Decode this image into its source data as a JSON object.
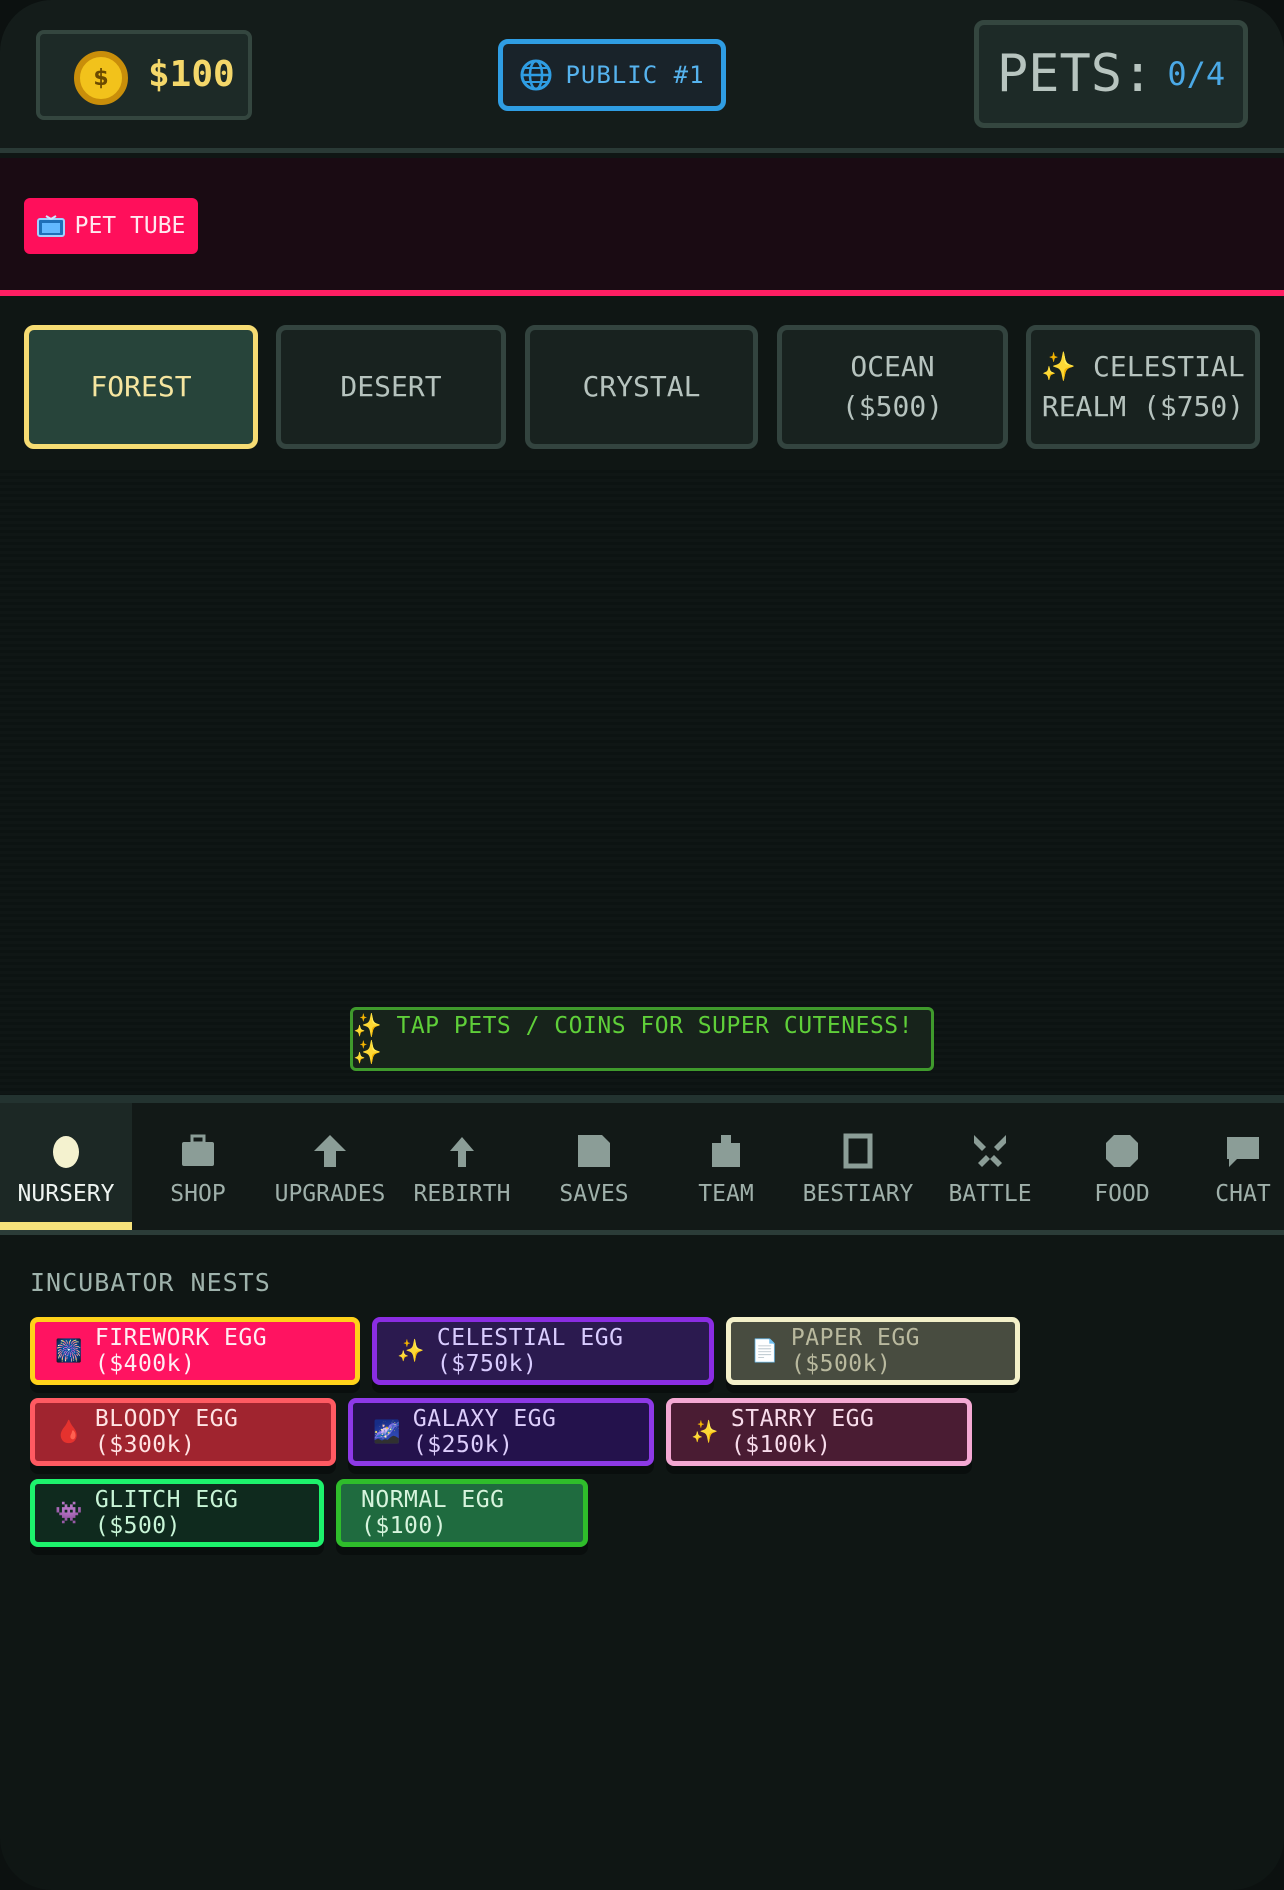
{
  "header": {
    "coins": "$100",
    "coin_symbol": "$",
    "server_label": "PUBLIC #1",
    "pets_label": "PETS:",
    "pets_count": "0/4"
  },
  "banner": {
    "tube_label": "PET TUBE"
  },
  "biomes": [
    {
      "label": "FOREST",
      "active": true
    },
    {
      "label": "DESERT",
      "active": false
    },
    {
      "label": "CRYSTAL",
      "active": false
    },
    {
      "label": "OCEAN ($500)",
      "active": false
    },
    {
      "label": "✨ CELESTIAL REALM ($750)",
      "active": false
    }
  ],
  "hint": "✨ TAP PETS / COINS FOR SUPER CUTENESS! ✨",
  "nav": [
    {
      "label": "NURSERY",
      "icon": "egg-icon",
      "active": true
    },
    {
      "label": "SHOP",
      "icon": "briefcase-icon",
      "active": false
    },
    {
      "label": "UPGRADES",
      "icon": "arrow-up-icon",
      "active": false
    },
    {
      "label": "REBIRTH",
      "icon": "arrow-up-small-icon",
      "active": false
    },
    {
      "label": "SAVES",
      "icon": "save-icon",
      "active": false
    },
    {
      "label": "TEAM",
      "icon": "team-icon",
      "active": false
    },
    {
      "label": "BESTIARY",
      "icon": "book-icon",
      "active": false
    },
    {
      "label": "BATTLE",
      "icon": "swords-icon",
      "active": false
    },
    {
      "label": "FOOD",
      "icon": "food-icon",
      "active": false
    },
    {
      "label": "CHAT",
      "icon": "chat-bubble-icon",
      "active": false
    }
  ],
  "incubator": {
    "title": "INCUBATOR NESTS",
    "eggs": [
      {
        "icon": "🎆",
        "label": "FIREWORK EGG ($400k)",
        "bg": "#ff1361",
        "border": "#ffd21a",
        "color": "#ffeef3"
      },
      {
        "icon": "✨",
        "label": "CELESTIAL EGG ($750k)",
        "bg": "#2b1a4f",
        "border": "#8a2de2",
        "color": "#d9ccff"
      },
      {
        "icon": "📄",
        "label": "PAPER EGG ($500k)",
        "bg": "#484c40",
        "border": "#f3f0c9",
        "color": "#b9b99e"
      },
      {
        "icon": "🩸",
        "label": "BLOODY EGG ($300k)",
        "bg": "#a0242f",
        "border": "#ff5a62",
        "color": "#ffe3e3"
      },
      {
        "icon": "🌌",
        "label": "GALAXY EGG ($250k)",
        "bg": "#24124c",
        "border": "#8d39e6",
        "color": "#dccdfb"
      },
      {
        "icon": "✨",
        "label": "STARRY EGG ($100k)",
        "bg": "#4a1c33",
        "border": "#f4a8d3",
        "color": "#f8dceb"
      },
      {
        "icon": "👾",
        "label": "GLITCH EGG ($500)",
        "bg": "#0f2a1e",
        "border": "#1df26c",
        "color": "#c8f5d7"
      },
      {
        "icon": "",
        "label": "NORMAL EGG ($100)",
        "bg": "#1f6b3f",
        "border": "#2fbd2b",
        "color": "#d7f4dd"
      }
    ]
  }
}
